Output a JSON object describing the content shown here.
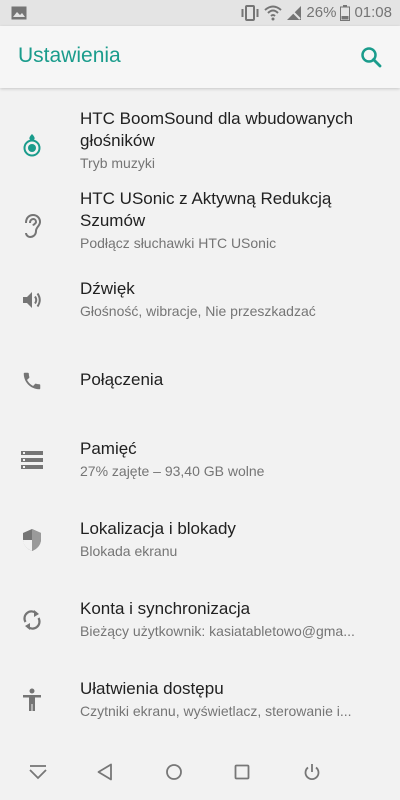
{
  "status_bar": {
    "battery_percent": "26%",
    "time": "01:08",
    "icons": [
      "image-icon",
      "vibrate-icon",
      "wifi-icon",
      "no-signal-icon",
      "battery-icon"
    ]
  },
  "app_bar": {
    "title": "Ustawienia",
    "search_icon": "search-icon",
    "accent_color": "#1a9c8c"
  },
  "settings": [
    {
      "title": "HTC BoomSound dla wbudowanych głośników",
      "subtitle": "Tryb muzyki",
      "icon": "boomsound-icon"
    },
    {
      "title": "HTC USonic z Aktywną Redukcją Szumów",
      "subtitle": "Podłącz słuchawki HTC USonic",
      "icon": "ear-icon"
    },
    {
      "title": "Dźwięk",
      "subtitle": "Głośność, wibracje, Nie przeszkadzać",
      "icon": "volume-icon"
    },
    {
      "title": "Połączenia",
      "subtitle": "",
      "icon": "phone-icon"
    },
    {
      "title": "Pamięć",
      "subtitle": "27% zajęte – 93,40 GB wolne",
      "icon": "storage-icon"
    },
    {
      "title": "Lokalizacja i blokady",
      "subtitle": "Blokada ekranu",
      "icon": "shield-icon"
    },
    {
      "title": "Konta i synchronizacja",
      "subtitle": "Bieżący użytkownik: kasiatabletowo@gma...",
      "icon": "sync-icon"
    },
    {
      "title": "Ułatwienia dostępu",
      "subtitle": "Czytniki ekranu, wyświetlacz, sterowanie i...",
      "icon": "accessibility-icon"
    }
  ],
  "nav_bar": {
    "icons": [
      "collapse-icon",
      "back-icon",
      "home-icon",
      "recents-icon",
      "power-icon"
    ]
  }
}
